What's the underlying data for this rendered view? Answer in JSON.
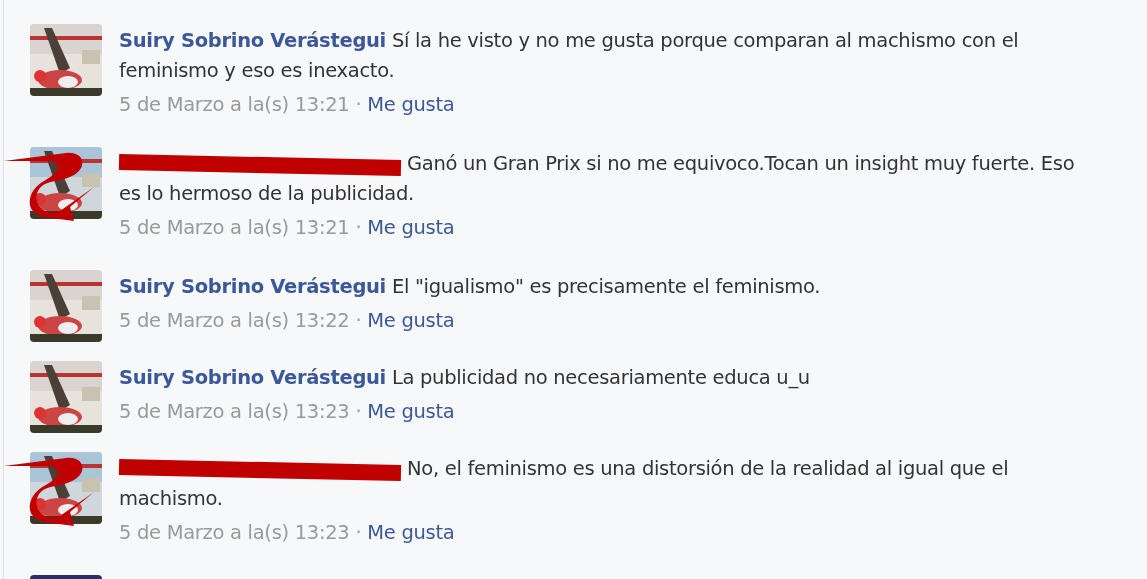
{
  "comments": [
    {
      "kind": "named",
      "author": "Suiry Sobrino Verástegui",
      "text": "Sí la he visto y no me gusta porque comparan al machismo con el feminismo y eso es inexacto.",
      "time": "5 de Marzo a la(s) 13:21",
      "separator": "·",
      "like": "Me gusta"
    },
    {
      "kind": "redacted",
      "text": "Ganó un Gran Prix si no me equivoco.Tocan un insight muy fuerte. Eso es lo hermoso de la publicidad.",
      "time": "5 de Marzo a la(s) 13:21",
      "separator": "·",
      "like": "Me gusta"
    },
    {
      "kind": "named",
      "author": "Suiry Sobrino Verástegui",
      "text": "El \"igualismo\" es precisamente el feminismo.",
      "time": "5 de Marzo a la(s) 13:22",
      "separator": "·",
      "like": "Me gusta"
    },
    {
      "kind": "named",
      "author": "Suiry Sobrino Verástegui",
      "text": "La publicidad no necesariamente educa u_u",
      "time": "5 de Marzo a la(s) 13:23",
      "separator": "·",
      "like": "Me gusta"
    },
    {
      "kind": "redacted",
      "text": "No, el feminismo es una distorsión de la realidad al igual que el machismo.",
      "time": "5 de Marzo a la(s) 13:23",
      "separator": "·",
      "like": "Me gusta"
    },
    {
      "kind": "partial"
    }
  ]
}
